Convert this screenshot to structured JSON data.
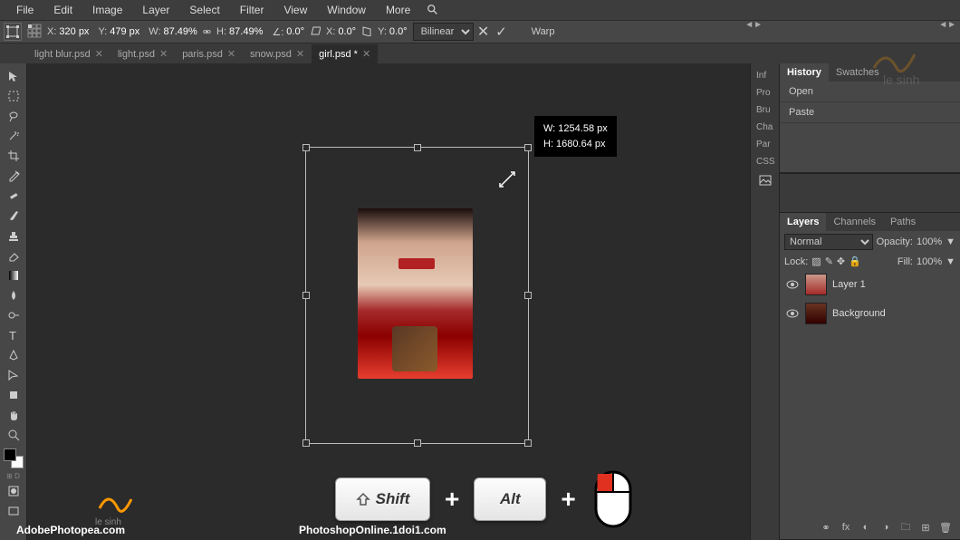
{
  "menu": [
    "File",
    "Edit",
    "Image",
    "Layer",
    "Select",
    "Filter",
    "View",
    "Window",
    "More"
  ],
  "options": {
    "x_label": "X:",
    "x_val": "320 px",
    "y_label": "Y:",
    "y_val": "479 px",
    "w_label": "W:",
    "w_val": "87.49%",
    "h_label": "H:",
    "h_val": "87.49%",
    "angle_label": "∠:",
    "angle_val": "0.0°",
    "sx_label": "X:",
    "sx_val": "0.0°",
    "sy_label": "Y:",
    "sy_val": "0.0°",
    "interpolation": "Bilinear",
    "warp": "Warp"
  },
  "tabs": [
    {
      "label": "light blur.psd",
      "active": false
    },
    {
      "label": "light.psd",
      "active": false
    },
    {
      "label": "paris.psd",
      "active": false
    },
    {
      "label": "snow.psd",
      "active": false
    },
    {
      "label": "girl.psd *",
      "active": true
    }
  ],
  "tooltip": {
    "line1": "W: 1254.58 px",
    "line2": "H: 1680.64 px"
  },
  "mini_rail": [
    "Inf",
    "Pro",
    "Bru",
    "Cha",
    "Par",
    "CSS"
  ],
  "history": {
    "tabs": [
      "History",
      "Swatches"
    ],
    "items": [
      "Open",
      "Paste"
    ]
  },
  "layers_panel": {
    "tabs": [
      "Layers",
      "Channels",
      "Paths"
    ],
    "blend": "Normal",
    "opacity_label": "Opacity:",
    "opacity_val": "100%",
    "lock_label": "Lock:",
    "fill_label": "Fill:",
    "fill_val": "100%",
    "layers": [
      {
        "name": "Layer 1"
      },
      {
        "name": "Background"
      }
    ]
  },
  "shortcuts": {
    "shift": "Shift",
    "alt": "Alt"
  },
  "footer": {
    "left": "AdobePhotopea.com",
    "center": "PhotoshopOnline.1doi1.com"
  },
  "watermark": "le sinh"
}
